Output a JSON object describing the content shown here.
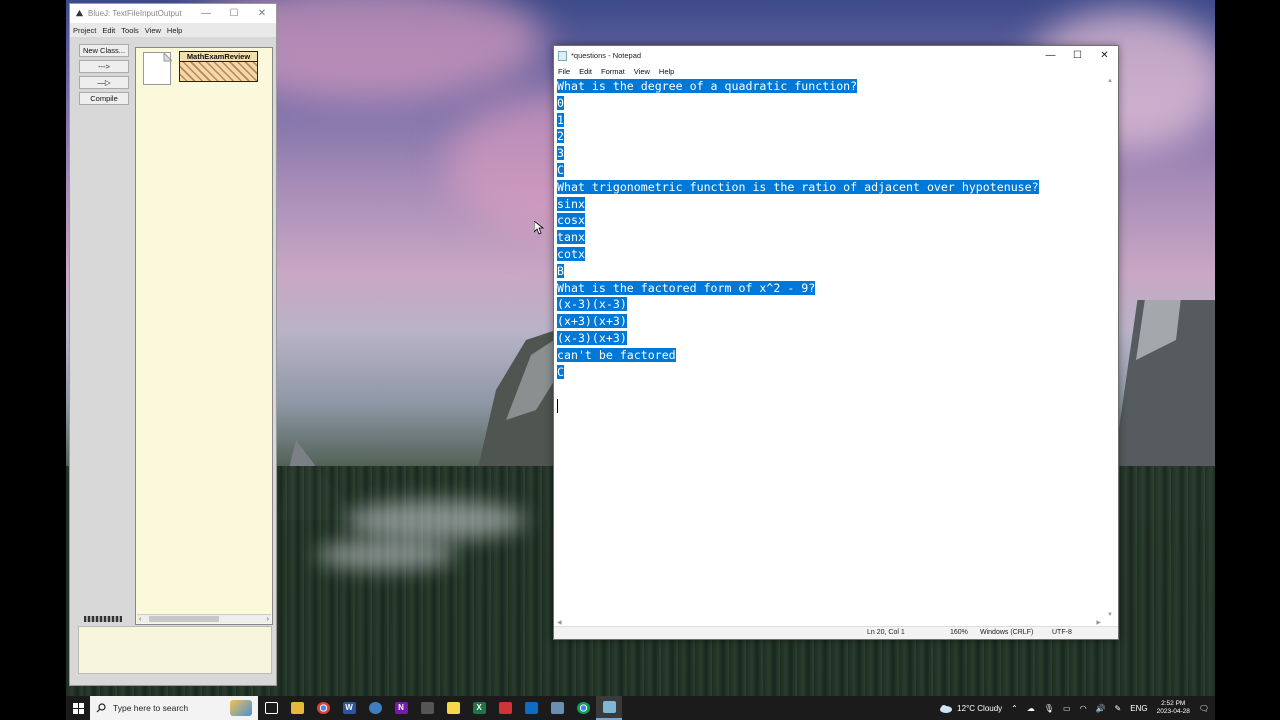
{
  "bluej": {
    "title": "BlueJ: TextFileInputOutput",
    "menu": [
      "Project",
      "Edit",
      "Tools",
      "View",
      "Help"
    ],
    "buttons": {
      "new_class": "New Class...",
      "dependency_arrow": "--->",
      "inheritance_arrow": "—▷",
      "compile": "Compile"
    },
    "class_name": "MathExamReview"
  },
  "notepad": {
    "title": "*questions - Notepad",
    "menu": [
      "File",
      "Edit",
      "Format",
      "View",
      "Help"
    ],
    "lines": [
      "What is the degree of a quadratic function?",
      "0",
      "1",
      "2",
      "3",
      "C",
      "What trigonometric function is the ratio of adjacent over hypotenuse?",
      "sinx",
      "cosx",
      "tanx",
      "cotx",
      "B",
      "What is the factored form of x^2 - 9?",
      "(x-3)(x-3)",
      "(x+3)(x+3)",
      "(x-3)(x+3)",
      "can't be factored",
      "C"
    ],
    "status": {
      "position": "Ln 20, Col 1",
      "zoom": "160%",
      "line_ending": "Windows (CRLF)",
      "encoding": "UTF-8"
    }
  },
  "taskbar": {
    "search_placeholder": "Type here to search",
    "weather": "12°C  Cloudy",
    "language": "ENG",
    "time": "2:52 PM",
    "date": "2023-04-28",
    "apps": [
      {
        "name": "task-view",
        "color": "#1b1b1b",
        "glyph": "⧉"
      },
      {
        "name": "file-explorer",
        "color": "#e8b83c",
        "glyph": ""
      },
      {
        "name": "chrome",
        "color": "#db4437",
        "glyph": ""
      },
      {
        "name": "word",
        "color": "#2b579a",
        "glyph": "W"
      },
      {
        "name": "edge-app",
        "color": "#3f7fbf",
        "glyph": ""
      },
      {
        "name": "onenote",
        "color": "#7719aa",
        "glyph": "N"
      },
      {
        "name": "bluej",
        "color": "#555",
        "glyph": ""
      },
      {
        "name": "sticky-notes",
        "color": "#f7d84a",
        "glyph": ""
      },
      {
        "name": "excel",
        "color": "#217346",
        "glyph": "X"
      },
      {
        "name": "media-app",
        "color": "#d13438",
        "glyph": ""
      },
      {
        "name": "vscode",
        "color": "#0e6cc4",
        "glyph": ""
      },
      {
        "name": "remote-app",
        "color": "#6a8fb5",
        "glyph": ""
      },
      {
        "name": "chrome-2",
        "color": "#db4437",
        "glyph": ""
      },
      {
        "name": "notepad",
        "color": "#7fb7d8",
        "glyph": ""
      }
    ]
  }
}
